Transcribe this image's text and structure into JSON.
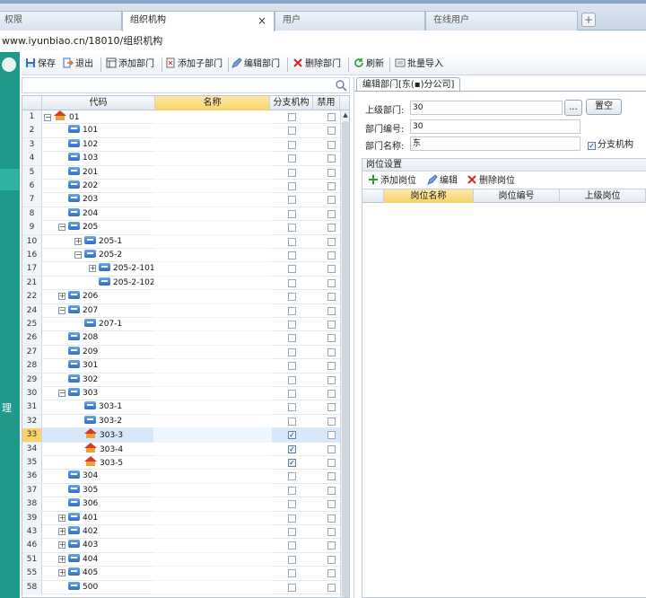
{
  "tabs": [
    {
      "label": "权限",
      "active": false
    },
    {
      "label": "组织机构",
      "active": true,
      "close": "×"
    },
    {
      "label": "用户",
      "active": false
    },
    {
      "label": "在线用户",
      "active": false
    }
  ],
  "tab_add": "+",
  "address": "www.iyunbiao.cn/18010/组织机构",
  "leftbar": {
    "text": "理"
  },
  "toolbar": [
    {
      "label": "保存",
      "icon": "save-icon"
    },
    {
      "label": "退出",
      "icon": "exit-icon"
    },
    {
      "label": "添加部门",
      "icon": "add-dept-icon"
    },
    {
      "label": "添加子部门",
      "icon": "add-subdept-icon"
    },
    {
      "label": "编辑部门",
      "icon": "edit-icon"
    },
    {
      "label": "删除部门",
      "icon": "delete-icon"
    },
    {
      "label": "刷新",
      "icon": "refresh-icon"
    },
    {
      "label": "批量导入",
      "icon": "import-icon"
    }
  ],
  "grid": {
    "headers": {
      "code": "代码",
      "name": "名称",
      "branch": "分支机构",
      "disabled": "禁用"
    },
    "rows": [
      {
        "n": "1",
        "code": "01",
        "level": 0,
        "expand": "−",
        "icon": "house",
        "branch": false
      },
      {
        "n": "2",
        "code": "101",
        "level": 1,
        "expand": "",
        "icon": "dept",
        "branch": false
      },
      {
        "n": "3",
        "code": "102",
        "level": 1,
        "expand": "",
        "icon": "dept",
        "branch": false
      },
      {
        "n": "4",
        "code": "103",
        "level": 1,
        "expand": "",
        "icon": "dept",
        "branch": false
      },
      {
        "n": "5",
        "code": "201",
        "level": 1,
        "expand": "",
        "icon": "dept",
        "branch": false
      },
      {
        "n": "6",
        "code": "202",
        "level": 1,
        "expand": "",
        "icon": "dept",
        "branch": false
      },
      {
        "n": "7",
        "code": "203",
        "level": 1,
        "expand": "",
        "icon": "dept",
        "branch": false
      },
      {
        "n": "8",
        "code": "204",
        "level": 1,
        "expand": "",
        "icon": "dept",
        "branch": false
      },
      {
        "n": "9",
        "code": "205",
        "level": 1,
        "expand": "−",
        "icon": "dept",
        "branch": false
      },
      {
        "n": "10",
        "code": "205-1",
        "level": 2,
        "expand": "+",
        "icon": "dept",
        "branch": false
      },
      {
        "n": "16",
        "code": "205-2",
        "level": 2,
        "expand": "−",
        "icon": "dept",
        "branch": false
      },
      {
        "n": "17",
        "code": "205-2-101",
        "level": 3,
        "expand": "+",
        "icon": "dept",
        "branch": false
      },
      {
        "n": "21",
        "code": "205-2-102",
        "level": 3,
        "expand": "",
        "icon": "dept",
        "branch": false
      },
      {
        "n": "22",
        "code": "206",
        "level": 1,
        "expand": "+",
        "icon": "dept",
        "branch": false
      },
      {
        "n": "24",
        "code": "207",
        "level": 1,
        "expand": "−",
        "icon": "dept",
        "branch": false
      },
      {
        "n": "25",
        "code": "207-1",
        "level": 2,
        "expand": "",
        "icon": "dept",
        "branch": false
      },
      {
        "n": "26",
        "code": "208",
        "level": 1,
        "expand": "",
        "icon": "dept",
        "branch": false
      },
      {
        "n": "27",
        "code": "209",
        "level": 1,
        "expand": "",
        "icon": "dept",
        "branch": false
      },
      {
        "n": "28",
        "code": "301",
        "level": 1,
        "expand": "",
        "icon": "dept",
        "branch": false
      },
      {
        "n": "29",
        "code": "302",
        "level": 1,
        "expand": "",
        "icon": "dept",
        "branch": false
      },
      {
        "n": "30",
        "code": "303",
        "level": 1,
        "expand": "−",
        "icon": "dept",
        "branch": false
      },
      {
        "n": "31",
        "code": "303-1",
        "level": 2,
        "expand": "",
        "icon": "dept",
        "branch": false
      },
      {
        "n": "32",
        "code": "303-2",
        "level": 2,
        "expand": "",
        "icon": "dept",
        "branch": false
      },
      {
        "n": "33",
        "code": "303-3",
        "level": 2,
        "expand": "",
        "icon": "house",
        "branch": true,
        "selected": true
      },
      {
        "n": "34",
        "code": "303-4",
        "level": 2,
        "expand": "",
        "icon": "house",
        "branch": true
      },
      {
        "n": "35",
        "code": "303-5",
        "level": 2,
        "expand": "",
        "icon": "house",
        "branch": true
      },
      {
        "n": "36",
        "code": "304",
        "level": 1,
        "expand": "",
        "icon": "dept",
        "branch": false
      },
      {
        "n": "37",
        "code": "305",
        "level": 1,
        "expand": "",
        "icon": "dept",
        "branch": false
      },
      {
        "n": "38",
        "code": "306",
        "level": 1,
        "expand": "",
        "icon": "dept",
        "branch": false
      },
      {
        "n": "39",
        "code": "401",
        "level": 1,
        "expand": "+",
        "icon": "dept",
        "branch": false
      },
      {
        "n": "43",
        "code": "402",
        "level": 1,
        "expand": "+",
        "icon": "dept",
        "branch": false
      },
      {
        "n": "46",
        "code": "403",
        "level": 1,
        "expand": "+",
        "icon": "dept",
        "branch": false
      },
      {
        "n": "51",
        "code": "404",
        "level": 1,
        "expand": "+",
        "icon": "dept",
        "branch": false
      },
      {
        "n": "55",
        "code": "405",
        "level": 1,
        "expand": "+",
        "icon": "dept",
        "branch": false
      },
      {
        "n": "58",
        "code": "500",
        "level": 1,
        "expand": "",
        "icon": "dept",
        "branch": false
      }
    ]
  },
  "editor": {
    "tab": "编辑部门[东(▪)分公司]",
    "parent_label": "上级部门:",
    "parent_value": "30",
    "parent_browse": "...",
    "clear_button": "置空",
    "code_label": "部门编号:",
    "code_value": "30",
    "name_label": "部门名称:",
    "name_value": "东",
    "branch_label": "分支机构",
    "branch_checked": true
  },
  "posts": {
    "title": "岗位设置",
    "add": "添加岗位",
    "edit": "编辑",
    "delete": "删除岗位",
    "headers": [
      "岗位名称",
      "岗位编号",
      "上级岗位"
    ]
  },
  "colors": {
    "accent_green": "#1f9a8a",
    "header_yellow": "#f8d26a",
    "selected_row": "#d7e8fb"
  }
}
